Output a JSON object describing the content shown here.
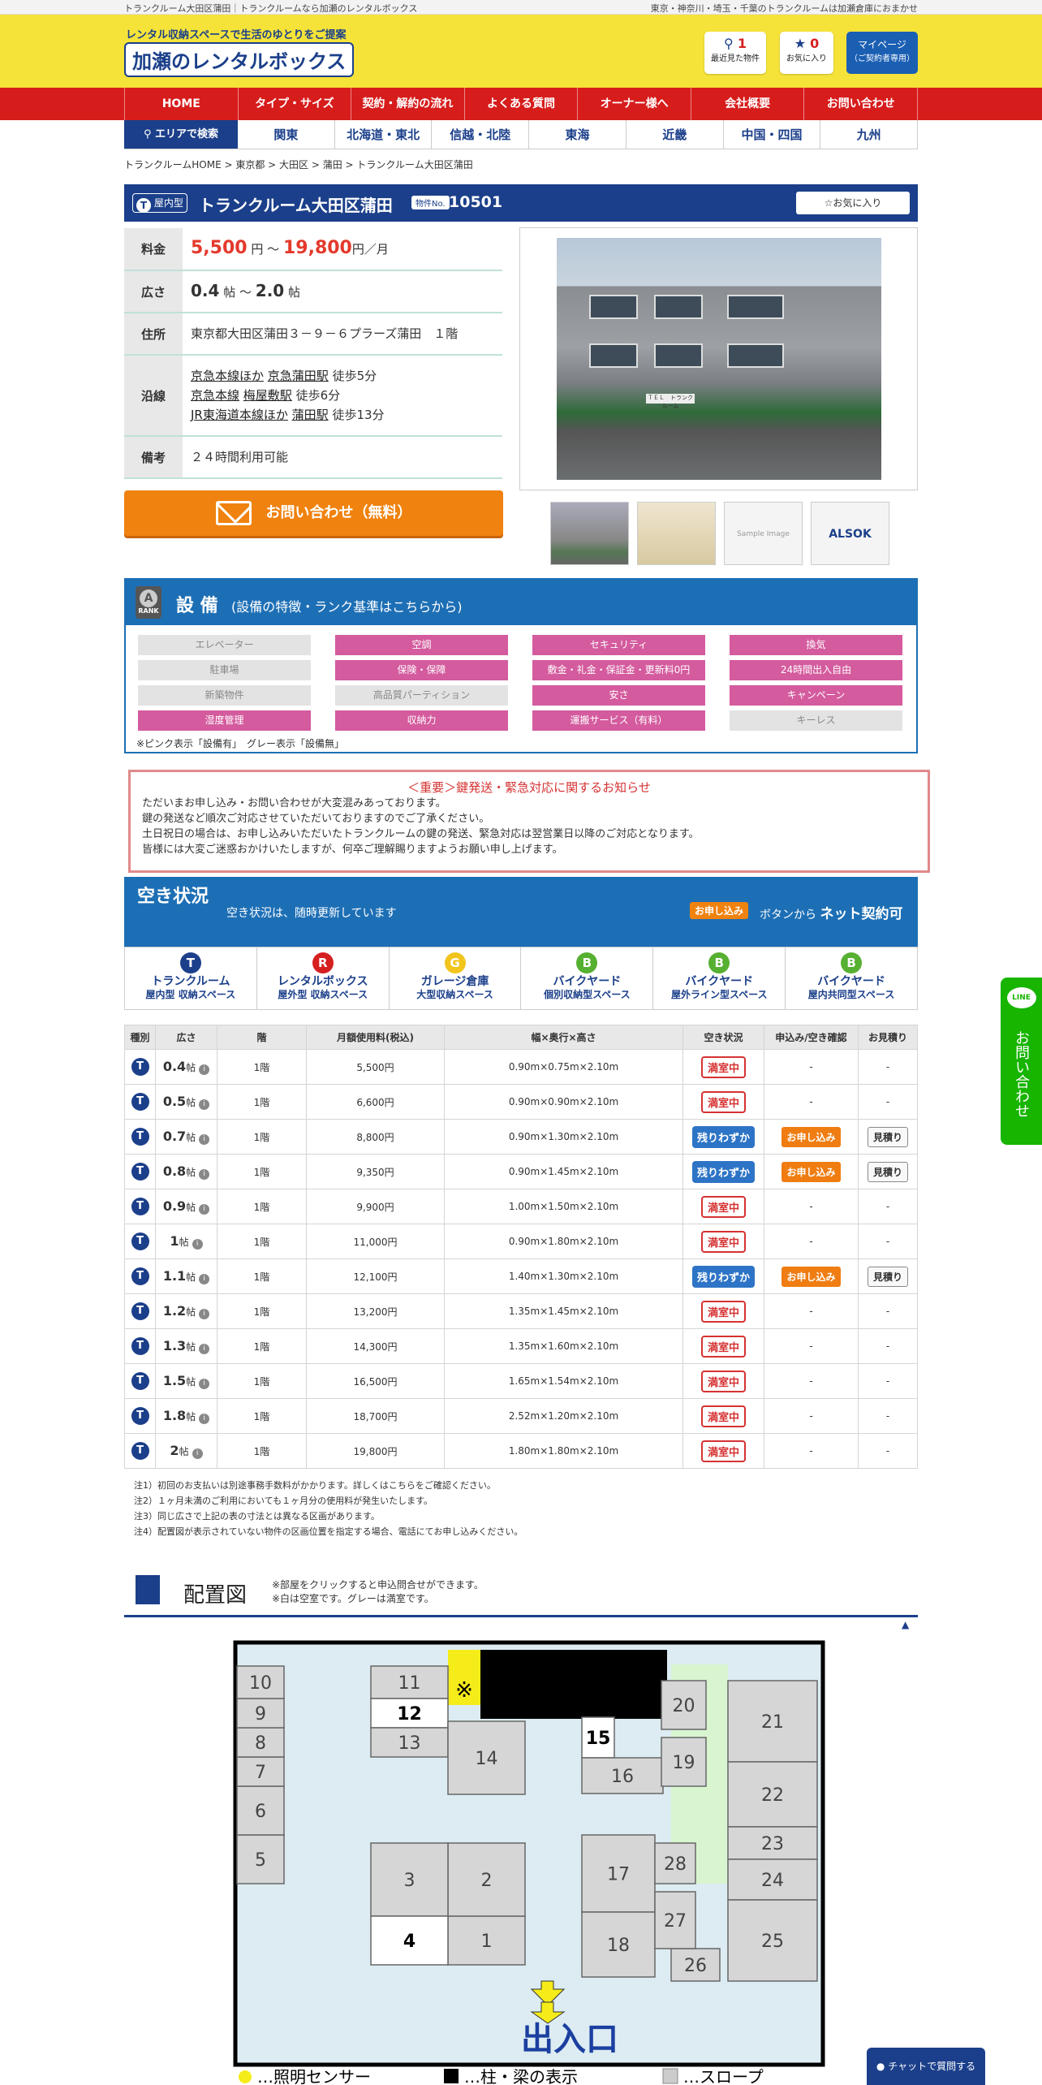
{
  "topbar": {
    "left": "トランクルーム大田区蒲田｜トランクルームなら加瀬のレンタルボックス",
    "right": "東京・神奈川・埼玉・千葉のトランクルームは加瀬倉庫におまかせ"
  },
  "header": {
    "tagline": "レンタル収納スペースで生活のゆとりをご提案",
    "logo": "加瀬のレンタルボックス",
    "recent_count": "1",
    "recent_label": "最近見た物件",
    "fav_count": "0",
    "fav_label": "お気に入り",
    "mypage": "マイページ",
    "mypage_sub": "（ご契約者専用）"
  },
  "gnav": [
    "HOME",
    "タイプ・サイズ",
    "契約・解約の流れ",
    "よくある質問",
    "オーナー様へ",
    "会社概要",
    "お問い合わせ"
  ],
  "area_nav": {
    "search": "エリアで検索",
    "items": [
      "関東",
      "北海道・東北",
      "信越・北陸",
      "東海",
      "近畿",
      "中国・四国",
      "九州"
    ]
  },
  "breadcrumb": "トランクルームHOME >  東京都 >  大田区 >  蒲田 >  トランクルーム大田区蒲田",
  "property": {
    "badge_icon": "T",
    "badge": "屋内型",
    "title": "トランクルーム大田区蒲田",
    "no_label": "物件No.",
    "no": "10501",
    "fav_button": "☆お気に入り",
    "price_label": "料金",
    "price_min": "5,500",
    "price_max": "19,800",
    "price_unit1": "円",
    "price_tilde": "～",
    "price_unit2": "円／月",
    "area_label": "広さ",
    "area_min": "0.4",
    "area_max": "2.0",
    "area_unit": "帖",
    "address_label": "住所",
    "address": "東京都大田区蒲田３－９－６プラーズ蒲田　１階",
    "line_label": "沿線",
    "lines": [
      {
        "line": "京急本線ほか",
        "station": "京急蒲田駅",
        "walk": "徒歩5分"
      },
      {
        "line": "京急本線",
        "station": "梅屋敷駅",
        "walk": "徒歩6分"
      },
      {
        "line": "JR東海道本線ほか",
        "station": "蒲田駅",
        "walk": "徒歩13分"
      }
    ],
    "note_label": "備考",
    "note": "２４時間利用可能",
    "contact_button": "お問い合わせ（無料）",
    "building_sign": "ＴＥＬ　トランクルーム"
  },
  "thumbs": [
    "",
    "",
    "Sample Image",
    "ALSOK"
  ],
  "equipment": {
    "rank_label": "RANK",
    "rank": "A",
    "title": "設 備",
    "subtitle": "(設備の特徴・ランク基準はこちらから)",
    "items": [
      {
        "label": "エレベーター",
        "on": false
      },
      {
        "label": "空調",
        "on": true
      },
      {
        "label": "セキュリティ",
        "on": true
      },
      {
        "label": "換気",
        "on": true
      },
      {
        "label": "駐車場",
        "on": false
      },
      {
        "label": "保険・保障",
        "on": true
      },
      {
        "label": "敷金・礼金・保証金・更新料0円",
        "on": true
      },
      {
        "label": "24時間出入自由",
        "on": true
      },
      {
        "label": "新築物件",
        "on": false
      },
      {
        "label": "高品質パーティション",
        "on": false
      },
      {
        "label": "安さ",
        "on": true
      },
      {
        "label": "キャンペーン",
        "on": true
      },
      {
        "label": "湿度管理",
        "on": true
      },
      {
        "label": "収納力",
        "on": true
      },
      {
        "label": "運搬サービス（有料）",
        "on": true
      },
      {
        "label": "キーレス",
        "on": false
      }
    ],
    "note": "※ピンク表示「設備有」　グレー表示「設備無」"
  },
  "notice": {
    "title": "＜重要＞鍵発送・緊急対応に関するお知らせ",
    "lines": [
      "ただいまお申し込み・お問い合わせが大変混みあっております。",
      "鍵の発送など順次ご対応させていただいておりますのでご了承ください。",
      "土日祝日の場合は、お申し込みいただいたトランクルームの鍵の発送、緊急対応は翌営業日以降のご対応となります。",
      "皆様には大変ご迷惑おかけいたしますが、何卒ご理解賜りますようお願い申し上げます。"
    ]
  },
  "vacancy": {
    "title": "空き状況",
    "subtitle": "空き状況は、随時更新しています",
    "apply_label": "お申し込み",
    "apply_text": "ボタンから",
    "apply_bold": "ネット契約可"
  },
  "types": [
    {
      "icon": "T",
      "color": "#1b3f8a",
      "name": "トランクルーム",
      "sub": "屋内型 収納スペース"
    },
    {
      "icon": "R",
      "color": "#d61f1f",
      "name": "レンタルボックス",
      "sub": "屋外型 収納スペース"
    },
    {
      "icon": "G",
      "color": "#f2c51c",
      "name": "ガレージ倉庫",
      "sub": "大型収納スペース"
    },
    {
      "icon": "B",
      "color": "#56b031",
      "name": "バイクヤード",
      "sub": "個別収納型スペース"
    },
    {
      "icon": "B",
      "color": "#56b031",
      "name": "バイクヤード",
      "sub": "屋外ライン型スペース"
    },
    {
      "icon": "B",
      "color": "#56b031",
      "name": "バイクヤード",
      "sub": "屋内共同型スペース"
    }
  ],
  "table": {
    "headers": [
      "種別",
      "広さ",
      "階",
      "月額使用料(税込)",
      "幅×奥行×高さ",
      "空き状況",
      "申込み/空き確認",
      "お見積り"
    ],
    "rows": [
      {
        "type": "T",
        "size": "0.4",
        "unit": "帖",
        "floor": "1階",
        "price": "5,500円",
        "dim": "0.90m×0.75m×2.10m",
        "status": "満室中",
        "apply": "-",
        "est": "-"
      },
      {
        "type": "T",
        "size": "0.5",
        "unit": "帖",
        "floor": "1階",
        "price": "6,600円",
        "dim": "0.90m×0.90m×2.10m",
        "status": "満室中",
        "apply": "-",
        "est": "-"
      },
      {
        "type": "T",
        "size": "0.7",
        "unit": "帖",
        "floor": "1階",
        "price": "8,800円",
        "dim": "0.90m×1.30m×2.10m",
        "status": "残りわずか",
        "apply": "お申し込み",
        "est": "見積り"
      },
      {
        "type": "T",
        "size": "0.8",
        "unit": "帖",
        "floor": "1階",
        "price": "9,350円",
        "dim": "0.90m×1.45m×2.10m",
        "status": "残りわずか",
        "apply": "お申し込み",
        "est": "見積り"
      },
      {
        "type": "T",
        "size": "0.9",
        "unit": "帖",
        "floor": "1階",
        "price": "9,900円",
        "dim": "1.00m×1.50m×2.10m",
        "status": "満室中",
        "apply": "-",
        "est": "-"
      },
      {
        "type": "T",
        "size": "1",
        "unit": "帖",
        "floor": "1階",
        "price": "11,000円",
        "dim": "0.90m×1.80m×2.10m",
        "status": "満室中",
        "apply": "-",
        "est": "-"
      },
      {
        "type": "T",
        "size": "1.1",
        "unit": "帖",
        "floor": "1階",
        "price": "12,100円",
        "dim": "1.40m×1.30m×2.10m",
        "status": "残りわずか",
        "apply": "お申し込み",
        "est": "見積り"
      },
      {
        "type": "T",
        "size": "1.2",
        "unit": "帖",
        "floor": "1階",
        "price": "13,200円",
        "dim": "1.35m×1.45m×2.10m",
        "status": "満室中",
        "apply": "-",
        "est": "-"
      },
      {
        "type": "T",
        "size": "1.3",
        "unit": "帖",
        "floor": "1階",
        "price": "14,300円",
        "dim": "1.35m×1.60m×2.10m",
        "status": "満室中",
        "apply": "-",
        "est": "-"
      },
      {
        "type": "T",
        "size": "1.5",
        "unit": "帖",
        "floor": "1階",
        "price": "16,500円",
        "dim": "1.65m×1.54m×2.10m",
        "status": "満室中",
        "apply": "-",
        "est": "-"
      },
      {
        "type": "T",
        "size": "1.8",
        "unit": "帖",
        "floor": "1階",
        "price": "18,700円",
        "dim": "2.52m×1.20m×2.10m",
        "status": "満室中",
        "apply": "-",
        "est": "-"
      },
      {
        "type": "T",
        "size": "2",
        "unit": "帖",
        "floor": "1階",
        "price": "19,800円",
        "dim": "1.80m×1.80m×2.10m",
        "status": "満室中",
        "apply": "-",
        "est": "-"
      }
    ]
  },
  "notes": [
    "注1）初回のお支払いは別途事務手数料がかかります。詳しくはこちらをご確認ください。",
    "注2）１ヶ月未満のご利用においても１ヶ月分の使用料が発生いたします。",
    "注3）同じ広さで上記の表の寸法とは異なる区画があります。",
    "注4）配置図が表示されていない物件の区画位置を指定する場合、電話にてお申し込みください。"
  ],
  "layout": {
    "title": "配置図",
    "note1": "※部屋をクリックすると申込問合せができます。",
    "note2": "※白は空室です。グレーは満室です。",
    "top": "▲",
    "entrance": "出入口",
    "rooms": [
      "1",
      "2",
      "3",
      "4",
      "5",
      "6",
      "7",
      "8",
      "9",
      "10",
      "11",
      "12",
      "13",
      "14",
      "15",
      "16",
      "17",
      "18",
      "19",
      "20",
      "21",
      "22",
      "23",
      "24",
      "25",
      "26",
      "27",
      "28"
    ],
    "legend": [
      "…照明センサー",
      "…柱・梁の表示",
      "…スロープ"
    ],
    "mark": "※"
  },
  "line_widget": {
    "badge": "LINE",
    "text": "お問い合わせ"
  },
  "chat_widget": "チャットで質問する",
  "colors": {
    "brand_blue": "#1b3f8a",
    "nav_red": "#d71c1c",
    "header_yellow": "#f5e33a",
    "pink_on": "#d45b9e",
    "orange": "#f0820f",
    "line_green": "#17b400"
  }
}
